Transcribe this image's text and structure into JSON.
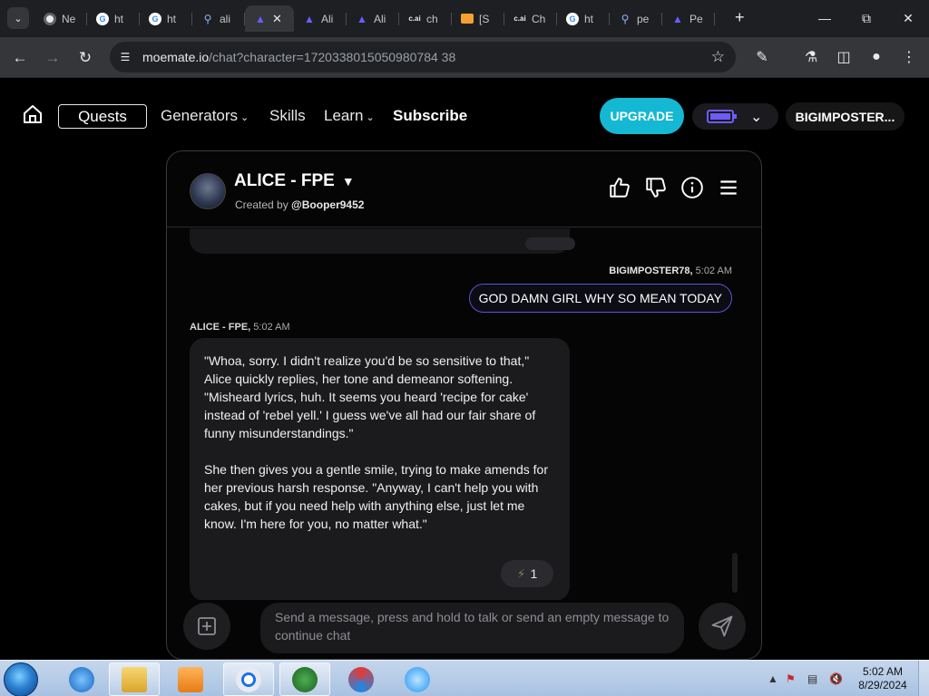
{
  "browser": {
    "tabs": [
      {
        "favicon": "chrome-icon",
        "label": "Ne"
      },
      {
        "favicon": "google-icon",
        "label": "ht"
      },
      {
        "favicon": "google-icon",
        "label": "ht"
      },
      {
        "favicon": "search-icon",
        "label": "ali"
      },
      {
        "favicon": "moemate-icon",
        "label": "",
        "active": true
      },
      {
        "favicon": "moemate-icon",
        "label": "Ali"
      },
      {
        "favicon": "moemate-icon",
        "label": "Ali"
      },
      {
        "favicon": "cai-icon",
        "label": "ch"
      },
      {
        "favicon": "mail-icon",
        "label": "[S"
      },
      {
        "favicon": "cai-icon",
        "label": "Ch"
      },
      {
        "favicon": "google-icon",
        "label": "ht"
      },
      {
        "favicon": "search-icon",
        "label": "pe"
      },
      {
        "favicon": "moemate-icon",
        "label": "Pe"
      }
    ],
    "url_domain": "moemate.io",
    "url_path": "/chat?character=1720338015050980784 38"
  },
  "site_nav": {
    "quests": "Quests",
    "generators": "Generators",
    "skills": "Skills",
    "learn": "Learn",
    "subscribe": "Subscribe",
    "upgrade": "UPGRADE",
    "username": "BIGIMPOSTER..."
  },
  "chat": {
    "character_name": "ALICE - FPE",
    "created_by_prefix": "Created by",
    "created_by_user": "@Booper9452",
    "user_sender": "BIGIMPOSTER78,",
    "user_time": "5:02 AM",
    "user_message": "GOD DAMN GIRL WHY SO MEAN TODAY",
    "bot_sender": "ALICE - FPE,",
    "bot_time": "5:02 AM",
    "bot_paragraph_1": "\"Whoa, sorry. I didn't realize you'd be so sensitive to that,\" Alice quickly replies, her tone and demeanor softening. \"Misheard lyrics, huh. It seems you heard 'recipe for cake' instead of 'rebel yell.' I guess we've all had our fair share of funny misunderstandings.\"",
    "bot_paragraph_2": "She then gives you a gentle smile, trying to make amends for her previous harsh response. \"Anyway, I can't help you with cakes, but if you need help with anything else, just let me know. I'm here for you, no matter what.\"",
    "reaction_count": "1",
    "input_placeholder": "Send a message, press and hold to talk or send an empty message to continue chat"
  },
  "taskbar": {
    "time": "5:02 AM",
    "date": "8/29/2024"
  },
  "colors": {
    "accent_purple": "#5b52d6",
    "upgrade_cyan": "#14b8d3",
    "battery_purple": "#6e5cf6"
  }
}
